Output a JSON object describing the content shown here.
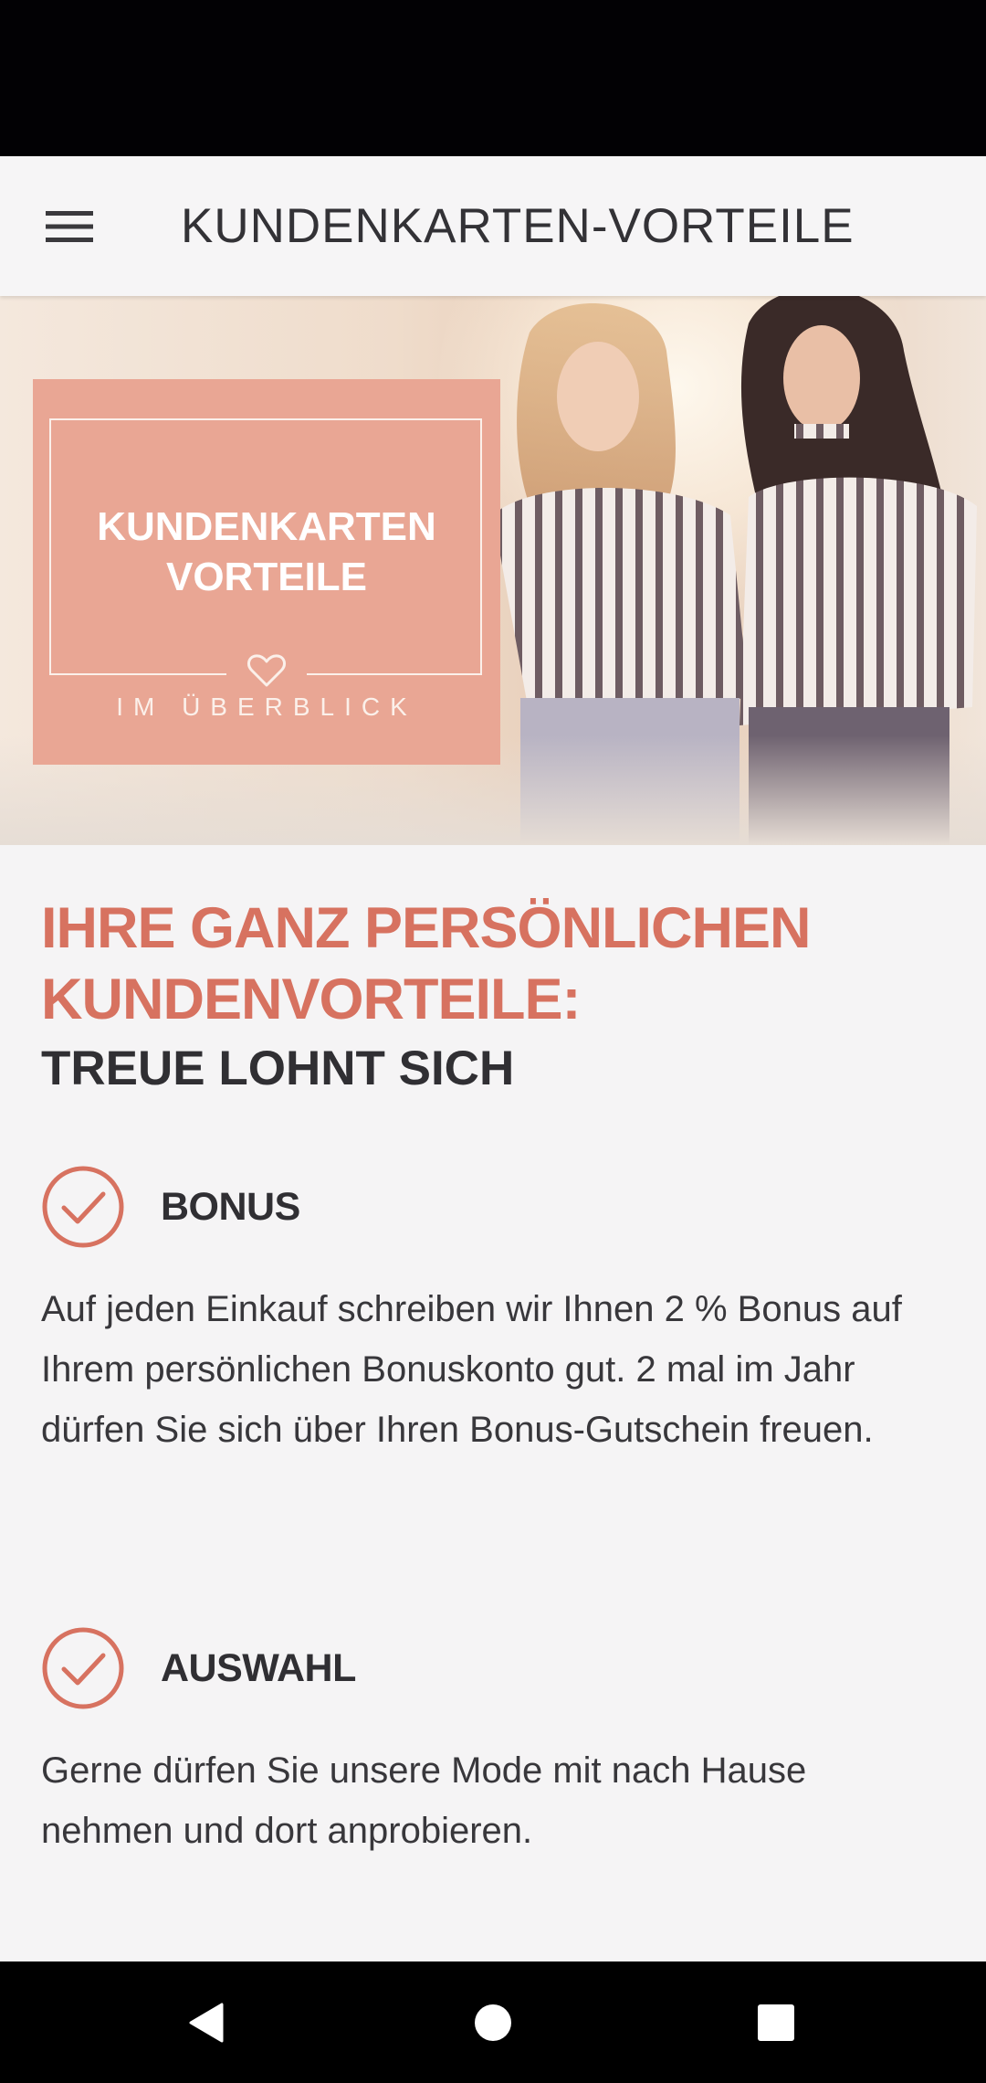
{
  "app_bar": {
    "title": "KUNDENKARTEN-VORTEILE",
    "menu_icon": "hamburger-menu-icon"
  },
  "hero": {
    "card_heading_line1": "KUNDENKARTEN",
    "card_heading_line2": "VORTEILE",
    "card_subtitle": "IM ÜBERBLICK",
    "heart_icon": "heart-outline-icon",
    "card_color": "#e9a694"
  },
  "content": {
    "headline_line1": "IHRE GANZ PERSÖNLICHEN",
    "headline_line2": "KUNDENVORTEILE:",
    "subheadline": "TREUE LOHNT SICH",
    "benefits": [
      {
        "title": "BONUS",
        "text": "Auf jeden Einkauf schreiben wir Ihnen 2 % Bonus auf Ihrem persönlichen Bonuskonto gut. 2 mal im Jahr dürfen Sie sich über Ihren Bonus-Gutschein freuen.",
        "icon": "check-circle-icon"
      },
      {
        "title": "AUSWAHL",
        "text": "Gerne dürfen Sie unsere Mode mit nach Hause nehmen und dort anprobieren.",
        "icon": "check-circle-icon"
      }
    ]
  },
  "nav_bar": {
    "back_icon": "back-triangle-icon",
    "home_icon": "home-circle-icon",
    "recents_icon": "recents-square-icon"
  },
  "colors": {
    "accent": "#d77260",
    "text_dark": "#302f33",
    "background": "#f5f4f5"
  }
}
